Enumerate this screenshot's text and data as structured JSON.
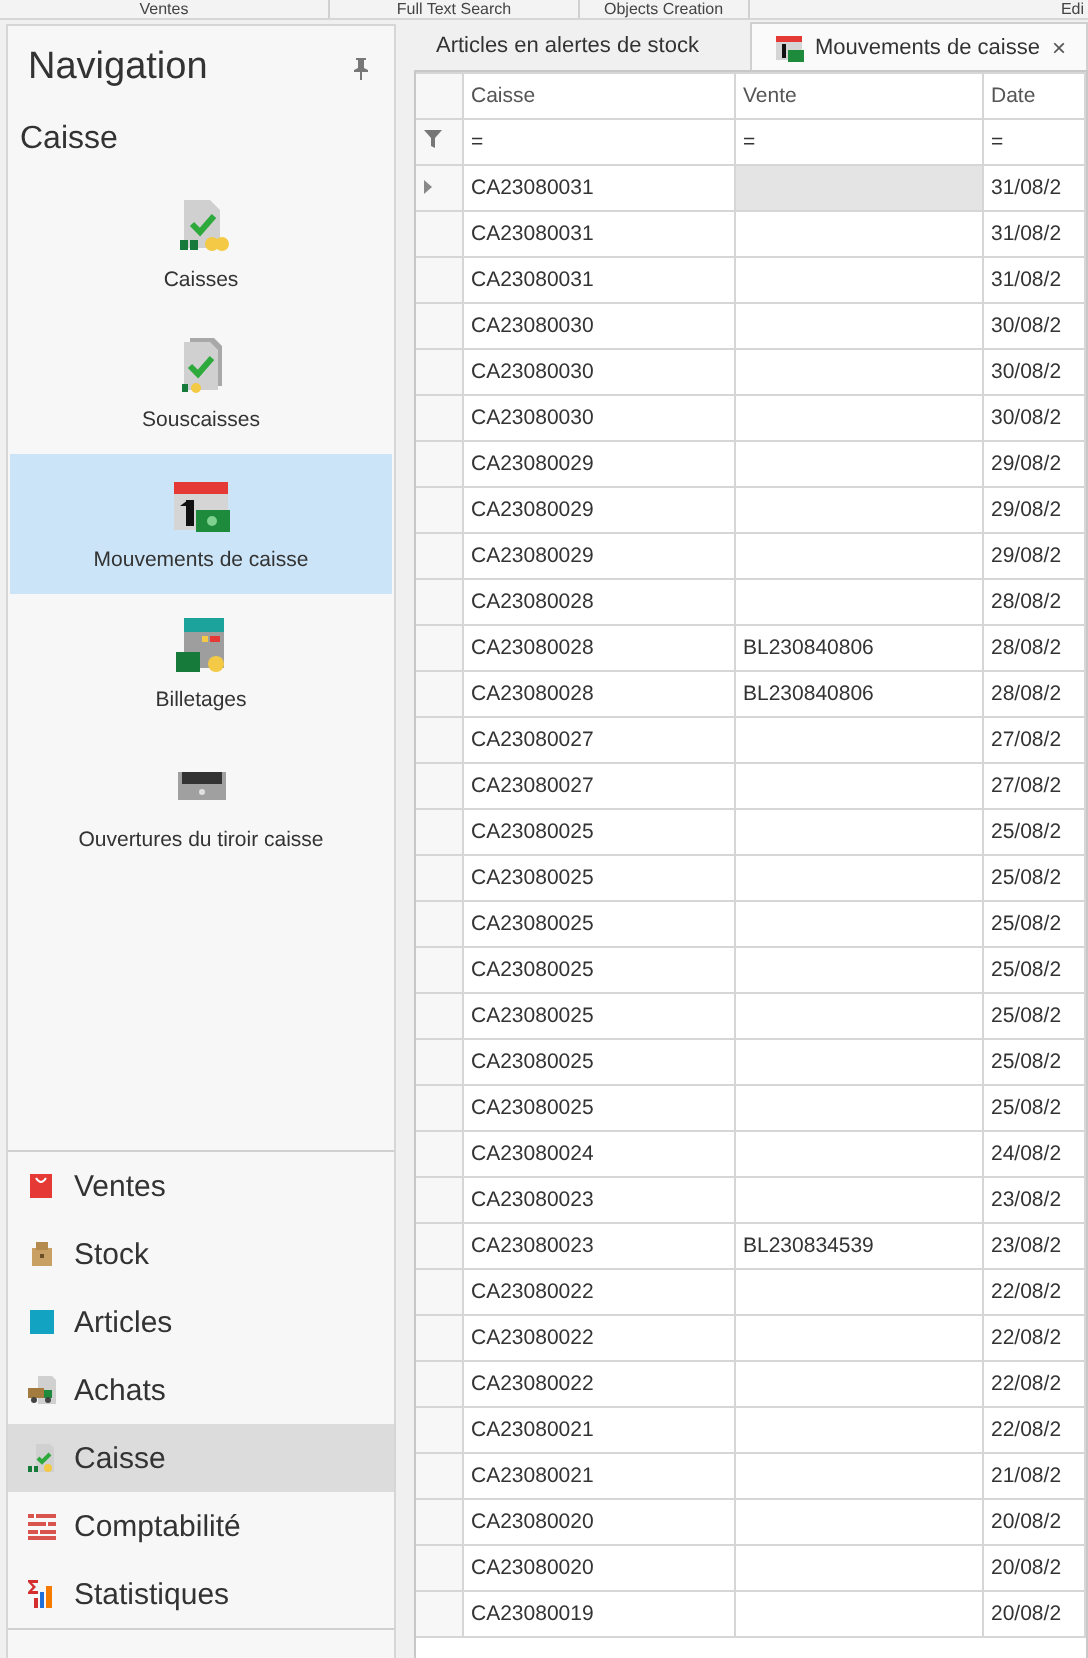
{
  "ribbon_tabs": [
    "Ventes",
    "Full Text Search",
    "Objects Creation",
    "Edi"
  ],
  "navigation": {
    "title": "Navigation",
    "group_title": "Caisse",
    "items": [
      {
        "label": "Caisses",
        "selected": false
      },
      {
        "label": "Souscaisses",
        "selected": false
      },
      {
        "label": "Mouvements de caisse",
        "selected": true
      },
      {
        "label": "Billetages",
        "selected": false
      },
      {
        "label": "Ouvertures du tiroir caisse",
        "selected": false
      }
    ],
    "groups": [
      {
        "label": "Ventes",
        "selected": false
      },
      {
        "label": "Stock",
        "selected": false
      },
      {
        "label": "Articles",
        "selected": false
      },
      {
        "label": "Achats",
        "selected": false
      },
      {
        "label": "Caisse",
        "selected": true
      },
      {
        "label": "Comptabilité",
        "selected": false
      },
      {
        "label": "Statistiques",
        "selected": false
      }
    ]
  },
  "document_tabs": [
    {
      "label": "Articles en alertes de stock",
      "selected": false
    },
    {
      "label": "Mouvements de caisse",
      "selected": true,
      "close": "×"
    }
  ],
  "table": {
    "columns": [
      "Caisse",
      "Vente",
      "Date"
    ],
    "filter_row": [
      "=",
      "=",
      "="
    ],
    "rows": [
      {
        "caisse": "CA23080031",
        "date": "31/08/2",
        "selected": true
      },
      {
        "caisse": "CA23080031",
        "date": "31/08/2",
        "selected": false
      },
      {
        "caisse": "CA23080031",
        "date": "31/08/2",
        "selected": false
      },
      {
        "caisse": "CA23080030",
        "date": "30/08/2",
        "selected": false
      },
      {
        "caisse": "CA23080030",
        "date": "30/08/2",
        "selected": false
      },
      {
        "caisse": "CA23080030",
        "date": "30/08/2",
        "selected": false
      },
      {
        "caisse": "CA23080029",
        "date": "29/08/2",
        "selected": false
      },
      {
        "caisse": "CA23080029",
        "date": "29/08/2",
        "selected": false
      },
      {
        "caisse": "CA23080029",
        "date": "29/08/2",
        "selected": false
      },
      {
        "caisse": "CA23080028",
        "date": "28/08/2",
        "selected": false
      },
      {
        "caisse": "CA23080028",
        "vente": "BL230840806",
        "date": "28/08/2",
        "selected": false
      },
      {
        "caisse": "CA23080028",
        "vente": "BL230840806",
        "date": "28/08/2",
        "selected": false
      },
      {
        "caisse": "CA23080027",
        "date": "27/08/2",
        "selected": false
      },
      {
        "caisse": "CA23080027",
        "date": "27/08/2",
        "selected": false
      },
      {
        "caisse": "CA23080025",
        "date": "25/08/2",
        "selected": false
      },
      {
        "caisse": "CA23080025",
        "date": "25/08/2",
        "selected": false
      },
      {
        "caisse": "CA23080025",
        "date": "25/08/2",
        "selected": false
      },
      {
        "caisse": "CA23080025",
        "date": "25/08/2",
        "selected": false
      },
      {
        "caisse": "CA23080025",
        "date": "25/08/2",
        "selected": false
      },
      {
        "caisse": "CA23080025",
        "date": "25/08/2",
        "selected": false
      },
      {
        "caisse": "CA23080025",
        "date": "25/08/2",
        "selected": false
      },
      {
        "caisse": "CA23080024",
        "date": "24/08/2",
        "selected": false
      },
      {
        "caisse": "CA23080023",
        "date": "23/08/2",
        "selected": false
      },
      {
        "caisse": "CA23080023",
        "vente": "BL230834539",
        "date": "23/08/2",
        "selected": false
      },
      {
        "caisse": "CA23080022",
        "date": "22/08/2",
        "selected": false
      },
      {
        "caisse": "CA23080022",
        "date": "22/08/2",
        "selected": false
      },
      {
        "caisse": "CA23080022",
        "date": "22/08/2",
        "selected": false
      },
      {
        "caisse": "CA23080021",
        "date": "22/08/2",
        "selected": false
      },
      {
        "caisse": "CA23080021",
        "date": "21/08/2",
        "selected": false
      },
      {
        "caisse": "CA23080020",
        "date": "20/08/2",
        "selected": false
      },
      {
        "caisse": "CA23080020",
        "date": "20/08/2",
        "selected": false
      },
      {
        "caisse": "CA23080019",
        "date": "20/08/2",
        "selected": false
      }
    ]
  }
}
